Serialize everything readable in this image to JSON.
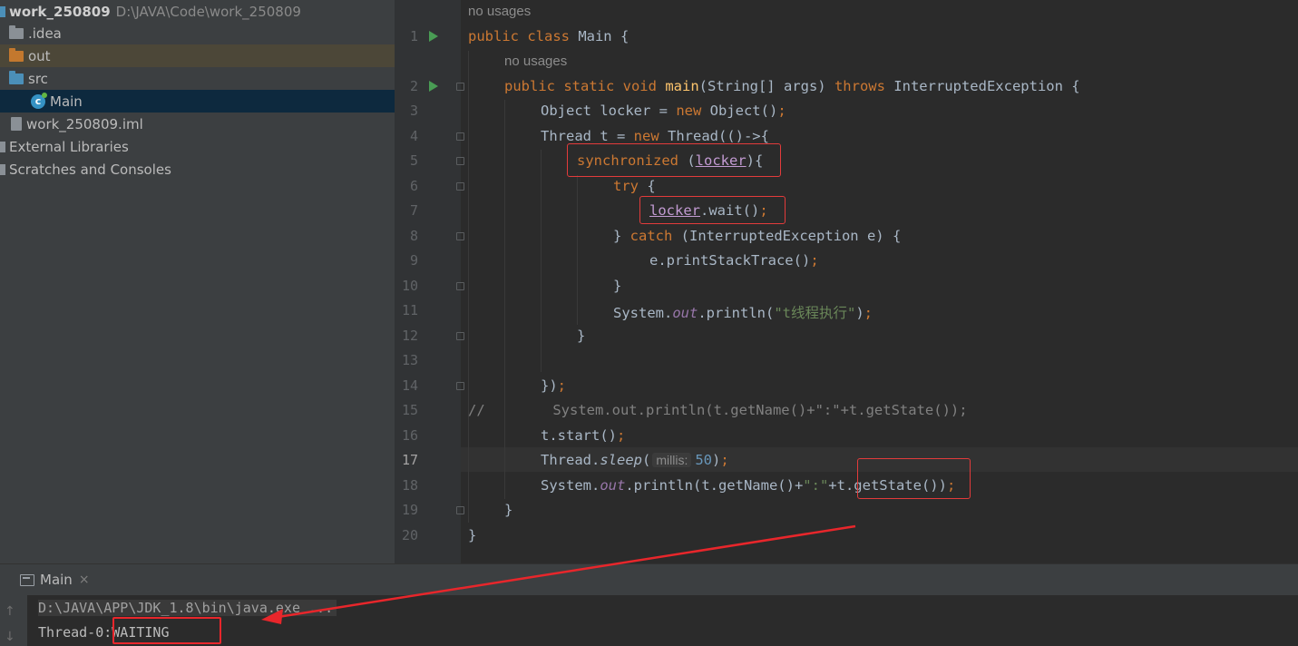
{
  "project": {
    "root_name": "work_250809",
    "root_path": "D:\\JAVA\\Code\\work_250809",
    "items": [
      {
        "label": ".idea",
        "icon": "folder-icon"
      },
      {
        "label": "out",
        "icon": "folder-orange-icon"
      },
      {
        "label": "src",
        "icon": "folder-source-icon"
      },
      {
        "label": "Main",
        "icon": "java-class-icon"
      },
      {
        "label": "work_250809.iml",
        "icon": "module-file-icon"
      },
      {
        "label": "External Libraries",
        "icon": "library-icon"
      },
      {
        "label": "Scratches and Consoles",
        "icon": "scratches-icon"
      }
    ]
  },
  "editor": {
    "usage_hint_class": "no usages",
    "usage_hint_method": "no usages",
    "current_line": 17,
    "line_numbers": [
      "1",
      "2",
      "3",
      "4",
      "5",
      "6",
      "7",
      "8",
      "9",
      "10",
      "11",
      "12",
      "13",
      "14",
      "15",
      "16",
      "17",
      "18",
      "19",
      "20"
    ],
    "lines": {
      "l1": {
        "kw": "public class",
        "rest": " Main {"
      },
      "l2": {
        "kw1": "public static void",
        "fn": "main",
        "args": "(String[] args) ",
        "kw2": "throws",
        "rest": " InterruptedException {"
      },
      "l3": {
        "a": "Object locker = ",
        "kw": "new",
        "b": " Object()",
        "semi": ";"
      },
      "l4": {
        "a": "Thread t = ",
        "kw": "new",
        "b": " Thread(()->{"
      },
      "l5": {
        "kw": "synchronized",
        "a": " (",
        "var": "locker",
        "b": "){"
      },
      "l6": {
        "kw": "try",
        "a": " {"
      },
      "l7": {
        "var": "locker",
        "a": ".wait()",
        "semi": ";"
      },
      "l8": {
        "a": "} ",
        "kw": "catch",
        "b": " (InterruptedException e) {"
      },
      "l9": {
        "a": "e.printStackTrace()",
        "semi": ";"
      },
      "l10": {
        "a": "}"
      },
      "l11": {
        "a": "System.",
        "field": "out",
        "b": ".println(",
        "str": "\"t线程执行\"",
        "c": ")",
        "semi": ";"
      },
      "l12": {
        "a": "}"
      },
      "l14": {
        "a": "})",
        "semi": ";"
      },
      "l15": {
        "a": "//        System.out.println(t.getName()+\":\"+t.getState());"
      },
      "l16": {
        "a": "t.start()",
        "semi": ";"
      },
      "l17": {
        "a": "Thread.",
        "it": "sleep",
        "b": "(",
        "inlay": "millis:",
        "num": "50",
        "c": ")",
        "semi": ";"
      },
      "l18": {
        "a": "System.",
        "field": "out",
        "b": ".println(t.getName()+",
        "str": "\":\"",
        "c": "+t.getState())",
        "semi": ";"
      },
      "l19": {
        "a": "}"
      },
      "l20": {
        "a": "}"
      }
    }
  },
  "run": {
    "tab_label": "Main",
    "close": "×",
    "command": "D:\\JAVA\\APP\\JDK_1.8\\bin\\java.exe ...",
    "output": "Thread-0:WAITING"
  },
  "colors": {
    "annotation_red": "#e33b3b",
    "keyword": "#cc7832",
    "string": "#6a8759"
  }
}
